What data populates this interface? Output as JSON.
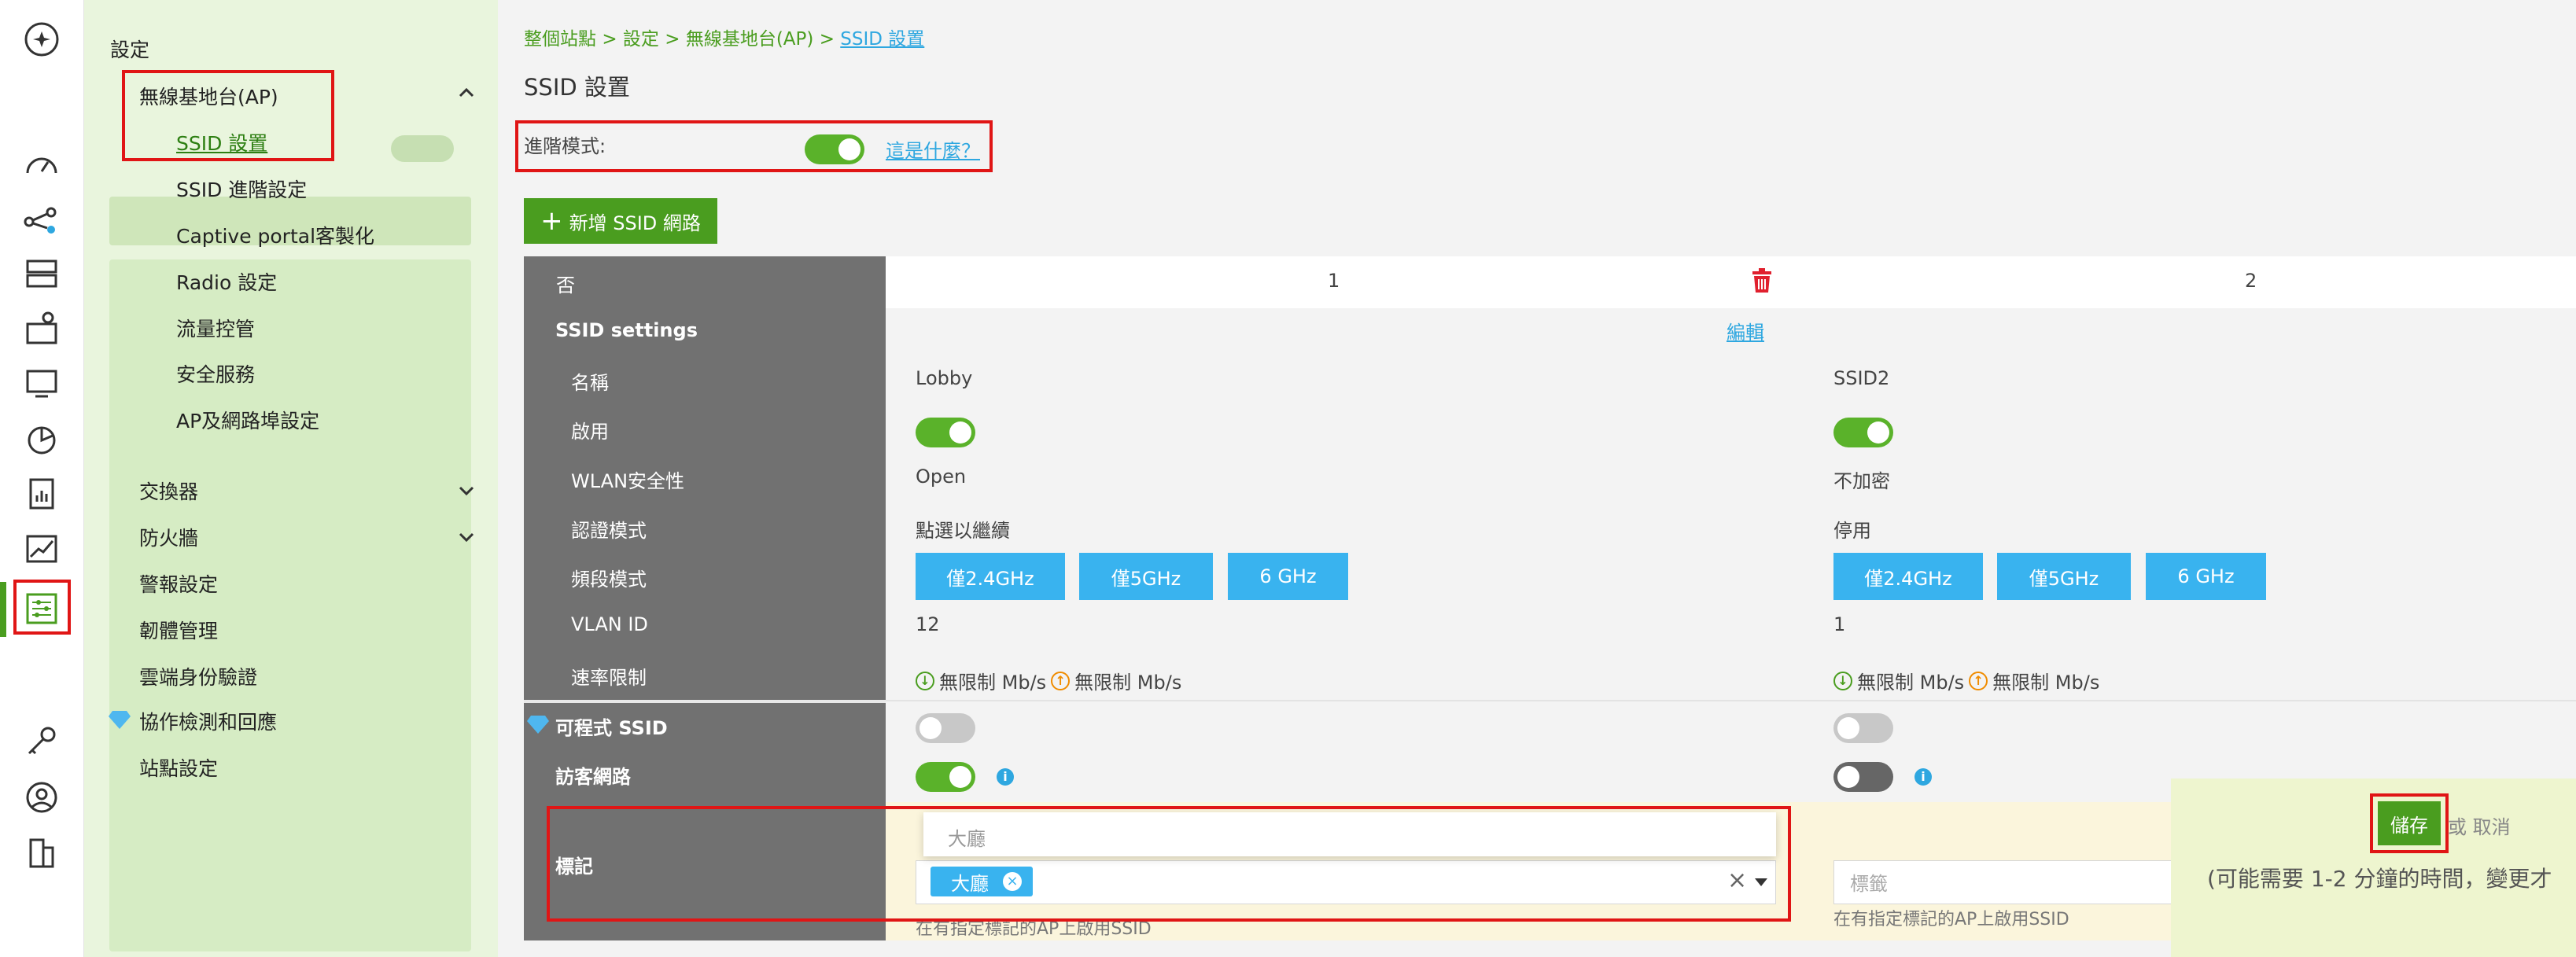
{
  "rail": {
    "icons": [
      "logo-icon",
      "dashboard-icon",
      "topology-icon",
      "devices-icon",
      "floorplan-icon",
      "monitor-icon",
      "analytics-icon",
      "report-icon",
      "trend-icon",
      "settings-icon",
      "key-icon",
      "support-icon",
      "building-icon"
    ]
  },
  "sidebar": {
    "title": "設定",
    "ap_group": "無線基地台(AP)",
    "ap_items": [
      "SSID 設置",
      "SSID 進階設定",
      "Captive portal客製化",
      "Radio 設定",
      "流量控管",
      "安全服務",
      "AP及網路埠設定"
    ],
    "groups": [
      "交換器",
      "防火牆",
      "警報設定",
      "韌體管理",
      "雲端身份驗證",
      "協作檢測和回應",
      "站點設定"
    ]
  },
  "breadcrumb": {
    "a": "整個站點",
    "b": "設定",
    "c": "無線基地台(AP)",
    "d": "SSID 設置",
    "sep": ">"
  },
  "page_title": "SSID 設置",
  "advanced": {
    "label": "進階模式:",
    "enabled": true,
    "help_link": "這是什麼？"
  },
  "add_button": "新增 SSID 網路",
  "table": {
    "header_label": "否",
    "columns": [
      "1",
      "2"
    ],
    "section": "SSID settings",
    "edit_link": "編輯",
    "rows": {
      "name": "名稱",
      "enable": "啟用",
      "security": "WLAN安全性",
      "auth": "認證模式",
      "band": "頻段模式",
      "vlan": "VLAN ID",
      "rate": "速率限制",
      "programmable": "可程式 SSID",
      "guest": "訪客網路",
      "tag": "標記"
    },
    "ssid1": {
      "name": "Lobby",
      "security": "Open",
      "auth": "點選以繼續",
      "bands": [
        "僅2.4GHz",
        "僅5GHz",
        "6 GHz"
      ],
      "vlan": "12",
      "rate_down": "無限制 Mb/s",
      "rate_up": "無限制 Mb/s",
      "tag_dropdown_option": "大廳",
      "tag_chip": "大廳",
      "tag_hint": "在有指定標記的AP上啟用SSID"
    },
    "ssid2": {
      "name": "SSID2",
      "security": "不加密",
      "auth": "停用",
      "bands": [
        "僅2.4GHz",
        "僅5GHz",
        "6 GHz"
      ],
      "vlan": "1",
      "rate_down": "無限制 Mb/s",
      "rate_up": "無限制 Mb/s",
      "tag_placeholder": "標籤",
      "tag_hint": "在有指定標記的AP上啟用SSID"
    }
  },
  "save_panel": {
    "save": "儲存",
    "or": "或",
    "cancel": "取消",
    "note": "(可能需要 1-2 分鐘的時間，變更才"
  },
  "colors": {
    "accent": "#4a9d1f",
    "band": "#39b3ef",
    "highlight": "#e01515",
    "label_col": "#717171"
  }
}
